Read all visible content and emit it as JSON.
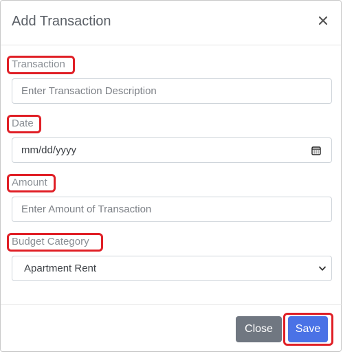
{
  "modal": {
    "title": "Add Transaction",
    "close_icon": "close-icon"
  },
  "fields": {
    "transaction": {
      "label": "Transaction",
      "placeholder": "Enter Transaction Description"
    },
    "date": {
      "label": "Date",
      "value": "mm/dd/yyyy",
      "icon": "calendar-icon"
    },
    "amount": {
      "label": "Amount",
      "placeholder": "Enter Amount of Transaction"
    },
    "category": {
      "label": "Budget Category",
      "selected": "Apartment Rent",
      "icon": "chevron-down-icon"
    }
  },
  "footer": {
    "close_label": "Close",
    "save_label": "Save"
  },
  "colors": {
    "annotation": "#e01f26",
    "primary": "#4a72e6",
    "secondary": "#707781"
  }
}
